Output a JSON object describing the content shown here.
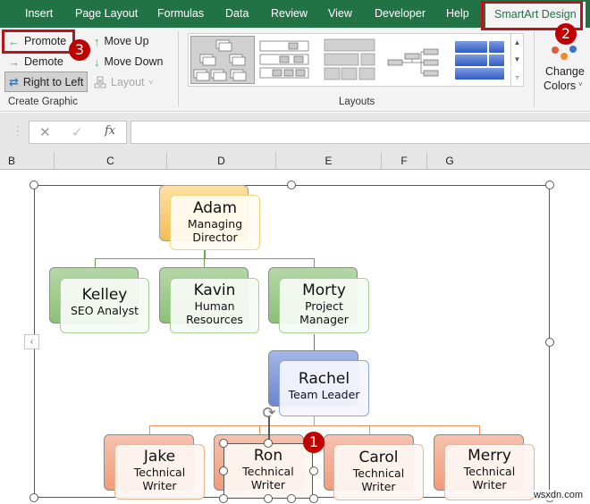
{
  "tabs": [
    {
      "label": "Insert"
    },
    {
      "label": "Page Layout"
    },
    {
      "label": "Formulas"
    },
    {
      "label": "Data"
    },
    {
      "label": "Review"
    },
    {
      "label": "View"
    },
    {
      "label": "Developer"
    },
    {
      "label": "Help"
    },
    {
      "label": "SmartArt Design",
      "active": true
    }
  ],
  "ribbon": {
    "create_graphic": {
      "promote": "Promote",
      "demote": "Demote",
      "right_to_left": "Right to Left",
      "move_up": "Move Up",
      "move_down": "Move Down",
      "layout": "Layout",
      "group_label": "Create Graphic"
    },
    "layouts": {
      "group_label": "Layouts",
      "thumbnails": [
        "organization-chart",
        "name-and-title-org-chart",
        "table-hierarchy",
        "horizontal-hierarchy",
        "architecture-layout"
      ],
      "selected_index": 0
    },
    "change_colors": {
      "line1": "Change",
      "line2": "Colors"
    }
  },
  "formula_bar": {
    "cancel_icon": "✕",
    "enter_icon": "✓",
    "fx_label": "fx",
    "value": ""
  },
  "columns": [
    "B",
    "C",
    "D",
    "E",
    "F",
    "G"
  ],
  "smartart": {
    "nodes": [
      {
        "id": "adam",
        "name": "Adam",
        "title_lines": [
          "Managing",
          "Director"
        ],
        "level": 0,
        "color": "orange"
      },
      {
        "id": "kelley",
        "name": "Kelley",
        "title_lines": [
          "SEO Analyst"
        ],
        "level": 1,
        "color": "green"
      },
      {
        "id": "kavin",
        "name": "Kavin",
        "title_lines": [
          "Human",
          "Resources"
        ],
        "level": 1,
        "color": "green"
      },
      {
        "id": "morty",
        "name": "Morty",
        "title_lines": [
          "Project",
          "Manager"
        ],
        "level": 1,
        "color": "green"
      },
      {
        "id": "rachel",
        "name": "Rachel",
        "title_lines": [
          "Team Leader"
        ],
        "level": 2,
        "color": "blue"
      },
      {
        "id": "jake",
        "name": "Jake",
        "title_lines": [
          "Technical",
          "Writer"
        ],
        "level": 3,
        "color": "salmon"
      },
      {
        "id": "ron",
        "name": "Ron",
        "title_lines": [
          "Technical",
          "Writer"
        ],
        "level": 3,
        "color": "salmon",
        "selected": true
      },
      {
        "id": "carol",
        "name": "Carol",
        "title_lines": [
          "Technical",
          "Writer"
        ],
        "level": 3,
        "color": "salmon"
      },
      {
        "id": "merry",
        "name": "Merry",
        "title_lines": [
          "Technical",
          "Writer"
        ],
        "level": 3,
        "color": "salmon"
      }
    ]
  },
  "annotations": [
    {
      "number": "1",
      "target": "ron-node"
    },
    {
      "number": "2",
      "target": "tab-smartart-design"
    },
    {
      "number": "3",
      "target": "promote-button"
    }
  ],
  "colors": {
    "excel_green": "#217346",
    "annotation_red": "#c00000",
    "orange_node": "#f6c86c",
    "green_node": "#93c47d",
    "blue_node": "#7f98d6",
    "salmon_node": "#f2a383"
  },
  "watermark": "wsxdn.com"
}
